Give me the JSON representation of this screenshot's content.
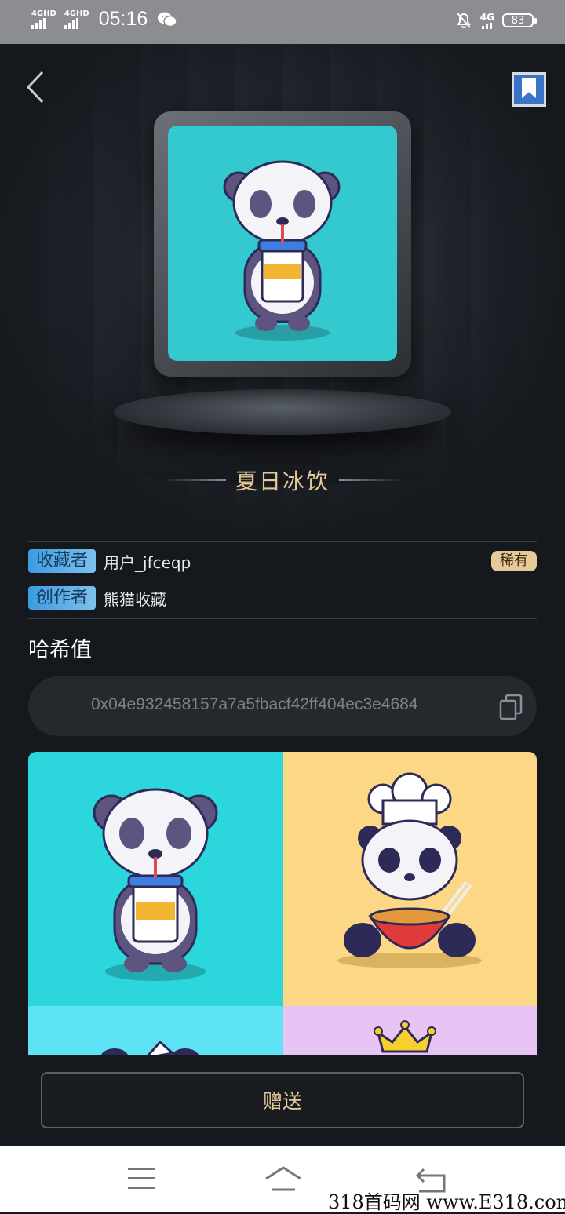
{
  "status_bar": {
    "signal1": "4GHD",
    "signal2": "4GHD",
    "time": "05:16",
    "network": "4G",
    "battery": "83"
  },
  "nft": {
    "title": "夏日冰饮",
    "rarity": "稀有"
  },
  "info": {
    "collector_label": "收藏者",
    "collector_value": "用户_jfceqp",
    "creator_label": "创作者",
    "creator_value": "熊猫收藏"
  },
  "hash": {
    "label": "哈希值",
    "value": "0x04e932458157a7a5fbacf42ff404ec3e4684"
  },
  "actions": {
    "send_label": "赠送"
  },
  "watermark": "318首码网 www.E318.com",
  "colors": {
    "gold": "#e6c999",
    "tag_blue": "#3b9be0",
    "teal": "#34c9cf",
    "yellow": "#fcd886"
  },
  "icons": [
    "back-icon",
    "bookmark-icon",
    "copy-icon",
    "menu-icon",
    "home-icon",
    "return-icon",
    "wechat-icon",
    "mute-icon"
  ]
}
